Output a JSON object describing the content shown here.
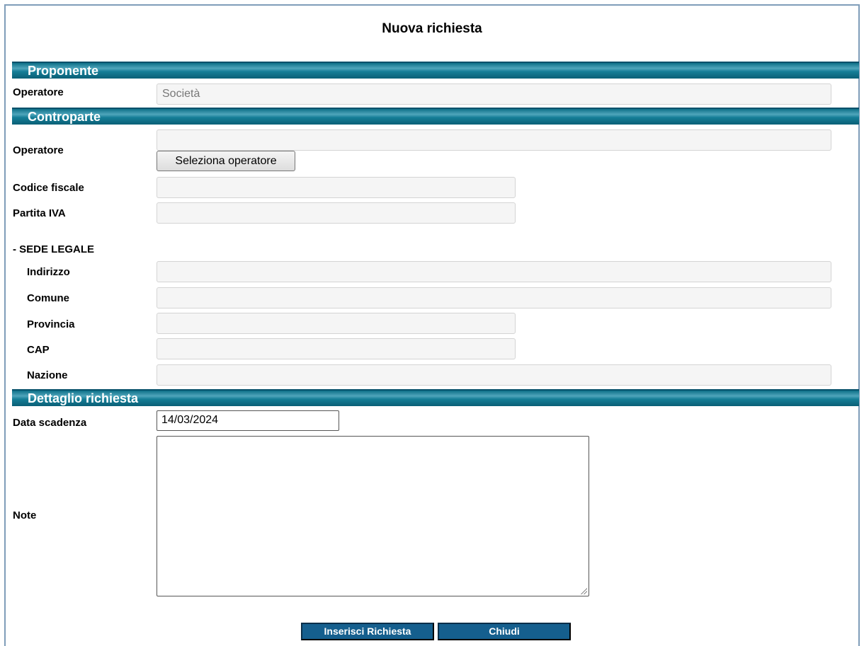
{
  "title": "Nuova richiesta",
  "sections": {
    "proponente": "Proponente",
    "controparte": "Controparte",
    "dettaglio": "Dettaglio richiesta"
  },
  "proponente": {
    "operatore_label": "Operatore",
    "operatore_value": "Società"
  },
  "controparte": {
    "operatore_label": "Operatore",
    "operatore_value": "",
    "select_button": "Seleziona operatore",
    "codice_fiscale_label": "Codice fiscale",
    "partita_iva_label": "Partita IVA",
    "sede_legale_label": "- SEDE LEGALE",
    "indirizzo_label": "Indirizzo",
    "comune_label": "Comune",
    "provincia_label": "Provincia",
    "cap_label": "CAP",
    "nazione_label": "Nazione"
  },
  "dettaglio": {
    "data_scadenza_label": "Data scadenza",
    "data_scadenza_value": "14/03/2024",
    "note_label": "Note",
    "note_value": ""
  },
  "actions": {
    "insert": "Inserisci Richiesta",
    "close": "Chiudi"
  },
  "colors": {
    "section_header": "#0e7088",
    "action_button": "#155f8e",
    "readonly_field": "#f5f5f5"
  }
}
